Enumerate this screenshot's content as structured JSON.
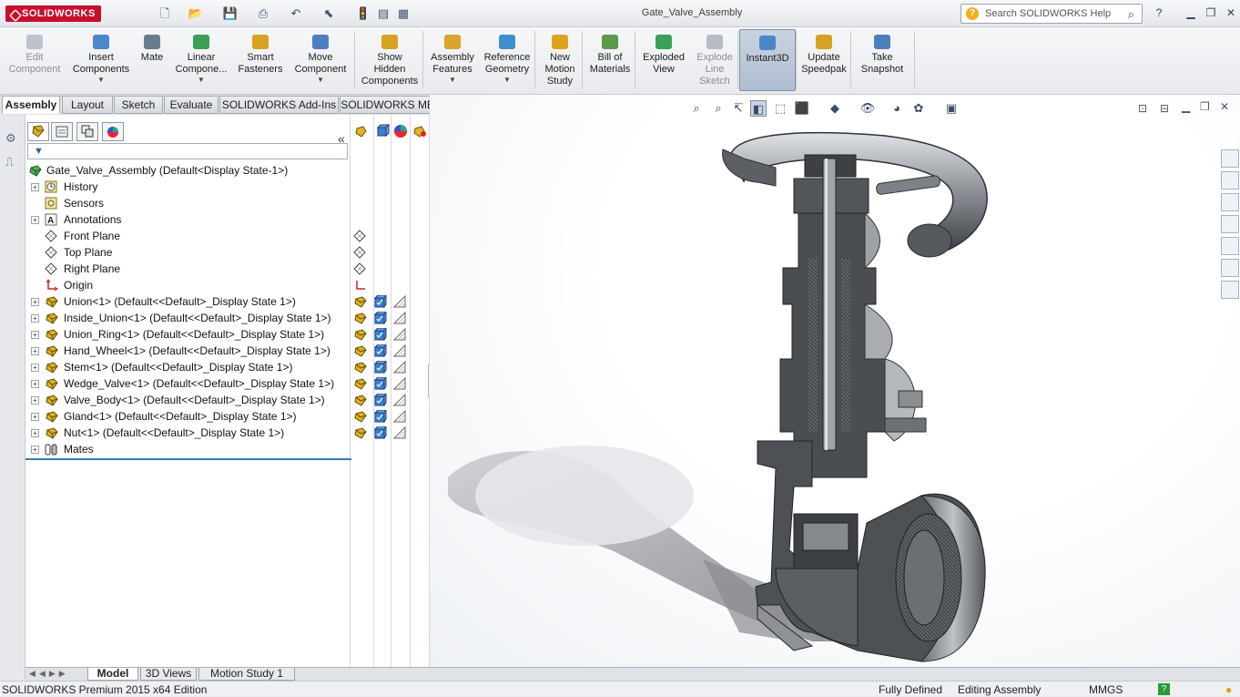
{
  "titlebar": {
    "logo": "SOLIDWORKS",
    "document_title": "Gate_Valve_Assembly",
    "search_placeholder": "Search SOLIDWORKS Help",
    "help": "?",
    "minimize": "▁",
    "restore": "❐",
    "close": "✕"
  },
  "ribbon": {
    "tools": [
      {
        "label": "Edit\nComponent",
        "icon": "edit-component-icon",
        "disabled": true
      },
      {
        "label": "Insert\nComponents",
        "icon": "insert-components-icon",
        "dropdown": true
      },
      {
        "label": "Mate",
        "icon": "mate-icon"
      },
      {
        "label": "Linear\nCompone...",
        "icon": "linear-pattern-icon",
        "dropdown": true
      },
      {
        "label": "Smart\nFasteners",
        "icon": "smart-fasteners-icon"
      },
      {
        "label": "Move\nComponent",
        "icon": "move-component-icon",
        "dropdown": true
      },
      {
        "label": "Show\nHidden\nComponents",
        "icon": "show-hidden-icon"
      },
      {
        "label": "Assembly\nFeatures",
        "icon": "assembly-features-icon",
        "dropdown": true
      },
      {
        "label": "Reference\nGeometry",
        "icon": "reference-geometry-icon",
        "dropdown": true
      },
      {
        "label": "New\nMotion\nStudy",
        "icon": "motion-study-icon"
      },
      {
        "label": "Bill of\nMaterials",
        "icon": "bom-icon"
      },
      {
        "label": "Exploded\nView",
        "icon": "exploded-view-icon"
      },
      {
        "label": "Explode\nLine\nSketch",
        "icon": "explode-line-icon",
        "disabled": true
      },
      {
        "label": "Instant3D",
        "icon": "instant3d-icon",
        "active": true
      },
      {
        "label": "Update\nSpeedpak",
        "icon": "speedpak-icon"
      },
      {
        "label": "Take\nSnapshot",
        "icon": "snapshot-icon"
      }
    ]
  },
  "command_tabs": [
    "Assembly",
    "Layout",
    "Sketch",
    "Evaluate",
    "SOLIDWORKS Add-Ins",
    "SOLIDWORKS MBD"
  ],
  "tree": {
    "root": "Gate_Valve_Assembly  (Default<Display State-1>)",
    "items": [
      {
        "label": "History",
        "icon": "history-icon",
        "expand": true
      },
      {
        "label": "Sensors",
        "icon": "sensors-icon",
        "expand": false
      },
      {
        "label": "Annotations",
        "icon": "annotations-icon",
        "expand": true
      },
      {
        "label": "Front Plane",
        "icon": "plane-icon",
        "expand": false,
        "disp": "plane"
      },
      {
        "label": "Top Plane",
        "icon": "plane-icon",
        "expand": false,
        "disp": "plane"
      },
      {
        "label": "Right Plane",
        "icon": "plane-icon",
        "expand": false,
        "disp": "plane"
      },
      {
        "label": "Origin",
        "icon": "origin-icon",
        "expand": false,
        "disp": "origin"
      },
      {
        "label": "Union<1> (Default<<Default>_Display State 1>)",
        "icon": "part-icon",
        "expand": true,
        "disp": "part"
      },
      {
        "label": "Inside_Union<1> (Default<<Default>_Display State 1>)",
        "icon": "part-icon",
        "expand": true,
        "disp": "part"
      },
      {
        "label": "Union_Ring<1> (Default<<Default>_Display State 1>)",
        "icon": "part-icon",
        "expand": true,
        "disp": "part"
      },
      {
        "label": "Hand_Wheel<1> (Default<<Default>_Display State 1>)",
        "icon": "part-icon",
        "expand": true,
        "disp": "part"
      },
      {
        "label": "Stem<1> (Default<<Default>_Display State 1>)",
        "icon": "part-icon",
        "expand": true,
        "disp": "part"
      },
      {
        "label": "Wedge_Valve<1> (Default<<Default>_Display State 1>)",
        "icon": "part-icon",
        "expand": true,
        "disp": "part"
      },
      {
        "label": "Valve_Body<1> (Default<<Default>_Display State 1>)",
        "icon": "part-icon",
        "expand": true,
        "disp": "part"
      },
      {
        "label": "Gland<1> (Default<<Default>_Display State 1>)",
        "icon": "part-icon",
        "expand": true,
        "disp": "part"
      },
      {
        "label": "Nut<1> (Default<<Default>_Display State 1>)",
        "icon": "part-icon",
        "expand": true,
        "disp": "part"
      },
      {
        "label": "Mates",
        "icon": "mates-icon",
        "expand": true
      }
    ]
  },
  "bottom_tabs": [
    "Model",
    "3D Views",
    "Motion Study 1"
  ],
  "status": {
    "product": "SOLIDWORKS Premium 2015 x64 Edition",
    "state": "Fully Defined",
    "mode": "Editing Assembly",
    "units": "MMGS"
  },
  "colors": {
    "accent": "#3d74b8",
    "logo": "#c8102e",
    "part_icon": "#e0b020",
    "model_dark": "#4a4d52",
    "model_light": "#b9bcc1"
  }
}
